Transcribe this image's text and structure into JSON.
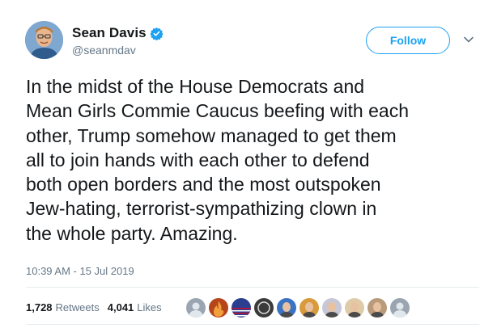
{
  "user": {
    "display_name": "Sean Davis",
    "handle": "@seanmdav",
    "verified": true,
    "avatar_icon": "user-avatar-photo"
  },
  "actions": {
    "follow_label": "Follow",
    "caret_icon": "chevron-down-icon"
  },
  "tweet": {
    "text": "In the midst of the House Democrats and\nMean Girls Commie Caucus beefing with each\nother, Trump somehow managed to get them\nall to join hands with each other to defend\nboth open borders and the most outspoken\nJew-hating, terrorist-sympathizing clown in\nthe whole party. Amazing.",
    "timestamp": "10:39 AM - 15 Jul 2019"
  },
  "stats": {
    "retweets_count": "1,728",
    "retweets_label": "Retweets",
    "likes_count": "4,041",
    "likes_label": "Likes"
  },
  "likers": [
    {
      "icon": "default-avatar-icon",
      "color": "#9aa5b1"
    },
    {
      "icon": "fire-avatar-icon",
      "color": "#b5451b"
    },
    {
      "icon": "flag-avatar-icon",
      "color": "#2a3f8f"
    },
    {
      "icon": "logo-avatar-icon",
      "color": "#3a3a3a"
    },
    {
      "icon": "person-avatar-icon",
      "color": "#3b73c4"
    },
    {
      "icon": "person-avatar-icon",
      "color": "#d99a3c"
    },
    {
      "icon": "person-avatar-icon",
      "color": "#c7c7d6"
    },
    {
      "icon": "person-avatar-icon",
      "color": "#e0cba8"
    },
    {
      "icon": "person-avatar-icon",
      "color": "#b99a7a"
    },
    {
      "icon": "default-avatar-icon",
      "color": "#9aa5b1"
    }
  ],
  "colors": {
    "accent": "#1da1f2",
    "secondary_text": "#657786",
    "primary_text": "#14171a"
  }
}
